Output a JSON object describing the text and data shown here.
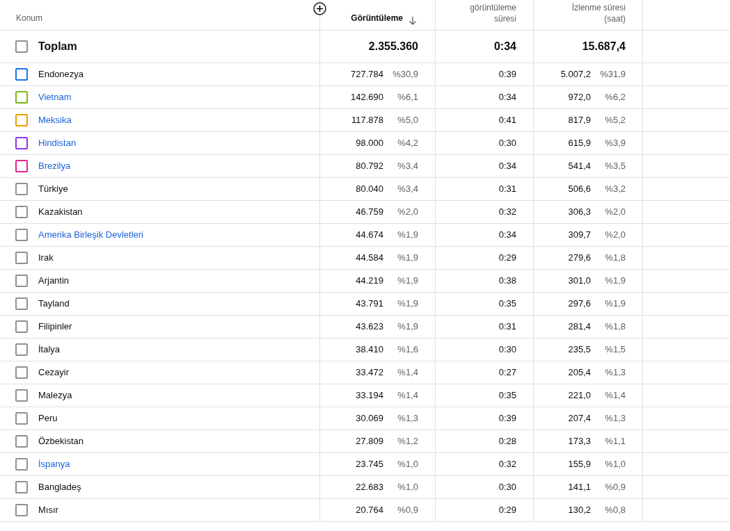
{
  "table": {
    "columns": [
      {
        "label": "Konum"
      },
      {
        "label": "Görüntüleme",
        "sorted": true
      },
      {
        "label": "görüntüleme süresi"
      },
      {
        "label": "İzlenme süresi (saat)"
      }
    ],
    "total": {
      "label": "Toplam",
      "checked": false,
      "views": "2.355.360",
      "avg_duration": "0:34",
      "watch_time": "15.687,4"
    },
    "rows": [
      {
        "name": "Endonezya",
        "link": false,
        "checked": false,
        "color": "#1a73e8",
        "views": "727.784",
        "views_pct": "%30,9",
        "avg_duration": "0:39",
        "watch_time": "5.007,2",
        "watch_pct": "%31,9"
      },
      {
        "name": "Vietnam",
        "link": true,
        "checked": false,
        "color": "#7cb518",
        "views": "142.690",
        "views_pct": "%6,1",
        "avg_duration": "0:34",
        "watch_time": "972,0",
        "watch_pct": "%6,2"
      },
      {
        "name": "Meksika",
        "link": true,
        "checked": false,
        "color": "#f29900",
        "views": "117.878",
        "views_pct": "%5,0",
        "avg_duration": "0:41",
        "watch_time": "817,9",
        "watch_pct": "%5,2"
      },
      {
        "name": "Hindistan",
        "link": true,
        "checked": false,
        "color": "#9334e6",
        "views": "98.000",
        "views_pct": "%4,2",
        "avg_duration": "0:30",
        "watch_time": "615,9",
        "watch_pct": "%3,9"
      },
      {
        "name": "Brezilya",
        "link": true,
        "checked": false,
        "color": "#e52592",
        "views": "80.792",
        "views_pct": "%3,4",
        "avg_duration": "0:34",
        "watch_time": "541,4",
        "watch_pct": "%3,5"
      },
      {
        "name": "Türkiye",
        "link": false,
        "checked": false,
        "color": "#909090",
        "views": "80.040",
        "views_pct": "%3,4",
        "avg_duration": "0:31",
        "watch_time": "506,6",
        "watch_pct": "%3,2"
      },
      {
        "name": "Kazakistan",
        "link": false,
        "checked": false,
        "color": "#909090",
        "views": "46.759",
        "views_pct": "%2,0",
        "avg_duration": "0:32",
        "watch_time": "306,3",
        "watch_pct": "%2,0"
      },
      {
        "name": "Amerika Birleşik Devletleri",
        "link": true,
        "checked": false,
        "color": "#909090",
        "views": "44.674",
        "views_pct": "%1,9",
        "avg_duration": "0:34",
        "watch_time": "309,7",
        "watch_pct": "%2,0"
      },
      {
        "name": "Irak",
        "link": false,
        "checked": false,
        "color": "#909090",
        "views": "44.584",
        "views_pct": "%1,9",
        "avg_duration": "0:29",
        "watch_time": "279,6",
        "watch_pct": "%1,8"
      },
      {
        "name": "Arjantin",
        "link": false,
        "checked": false,
        "color": "#909090",
        "views": "44.219",
        "views_pct": "%1,9",
        "avg_duration": "0:38",
        "watch_time": "301,0",
        "watch_pct": "%1,9"
      },
      {
        "name": "Tayland",
        "link": false,
        "checked": false,
        "color": "#909090",
        "views": "43.791",
        "views_pct": "%1,9",
        "avg_duration": "0:35",
        "watch_time": "297,6",
        "watch_pct": "%1,9"
      },
      {
        "name": "Filipinler",
        "link": false,
        "checked": false,
        "color": "#909090",
        "views": "43.623",
        "views_pct": "%1,9",
        "avg_duration": "0:31",
        "watch_time": "281,4",
        "watch_pct": "%1,8"
      },
      {
        "name": "İtalya",
        "link": false,
        "checked": false,
        "color": "#909090",
        "views": "38.410",
        "views_pct": "%1,6",
        "avg_duration": "0:30",
        "watch_time": "235,5",
        "watch_pct": "%1,5"
      },
      {
        "name": "Cezayir",
        "link": false,
        "checked": false,
        "color": "#909090",
        "views": "33.472",
        "views_pct": "%1,4",
        "avg_duration": "0:27",
        "watch_time": "205,4",
        "watch_pct": "%1,3"
      },
      {
        "name": "Malezya",
        "link": false,
        "checked": false,
        "color": "#909090",
        "views": "33.194",
        "views_pct": "%1,4",
        "avg_duration": "0:35",
        "watch_time": "221,0",
        "watch_pct": "%1,4"
      },
      {
        "name": "Peru",
        "link": false,
        "checked": false,
        "color": "#909090",
        "views": "30.069",
        "views_pct": "%1,3",
        "avg_duration": "0:39",
        "watch_time": "207,4",
        "watch_pct": "%1,3"
      },
      {
        "name": "Özbekistan",
        "link": false,
        "checked": false,
        "color": "#909090",
        "views": "27.809",
        "views_pct": "%1,2",
        "avg_duration": "0:28",
        "watch_time": "173,3",
        "watch_pct": "%1,1"
      },
      {
        "name": "İspanya",
        "link": true,
        "checked": false,
        "color": "#909090",
        "views": "23.745",
        "views_pct": "%1,0",
        "avg_duration": "0:32",
        "watch_time": "155,9",
        "watch_pct": "%1,0"
      },
      {
        "name": "Bangladeş",
        "link": false,
        "checked": false,
        "color": "#909090",
        "views": "22.683",
        "views_pct": "%1,0",
        "avg_duration": "0:30",
        "watch_time": "141,1",
        "watch_pct": "%0,9"
      },
      {
        "name": "Mısır",
        "link": false,
        "checked": false,
        "color": "#909090",
        "views": "20.764",
        "views_pct": "%0,9",
        "avg_duration": "0:29",
        "watch_time": "130,2",
        "watch_pct": "%0,8"
      }
    ]
  }
}
